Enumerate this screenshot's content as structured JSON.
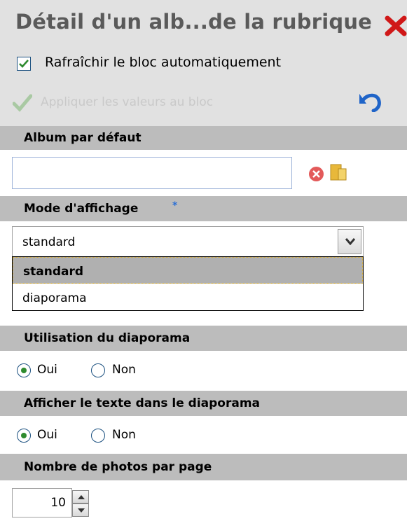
{
  "header": {
    "title": "Détail d'un alb...de la rubrique",
    "auto_refresh_label": "Rafraîchir le bloc automatiquement",
    "auto_refresh_checked": true,
    "apply_label": "Appliquer les valeurs au bloc"
  },
  "sections": {
    "album": {
      "label": "Album par défaut",
      "value": ""
    },
    "mode": {
      "label": "Mode d'affichage",
      "required_mark": "*",
      "selected": "standard",
      "options": [
        "standard",
        "diaporama"
      ]
    },
    "diaporama_use": {
      "label": "Utilisation du diaporama",
      "yes": "Oui",
      "no": "Non",
      "value": "Oui"
    },
    "diaporama_text": {
      "label": "Afficher le texte dans le diaporama",
      "yes": "Oui",
      "no": "Non",
      "value": "Oui"
    },
    "photos_per_page": {
      "label": "Nombre de photos par page",
      "value": "10"
    }
  },
  "icons": {
    "close": "close-x-icon",
    "apply": "checkmark-icon",
    "undo": "undo-arrow-icon",
    "clear": "clear-circle-icon",
    "browse": "folder-icon"
  },
  "colors": {
    "header_bg": "#e1e1e1",
    "section_bg": "#bcbcbc",
    "close_red": "#d01818",
    "radio_dot": "#2e8b2e",
    "undo_blue": "#1f64c8"
  }
}
